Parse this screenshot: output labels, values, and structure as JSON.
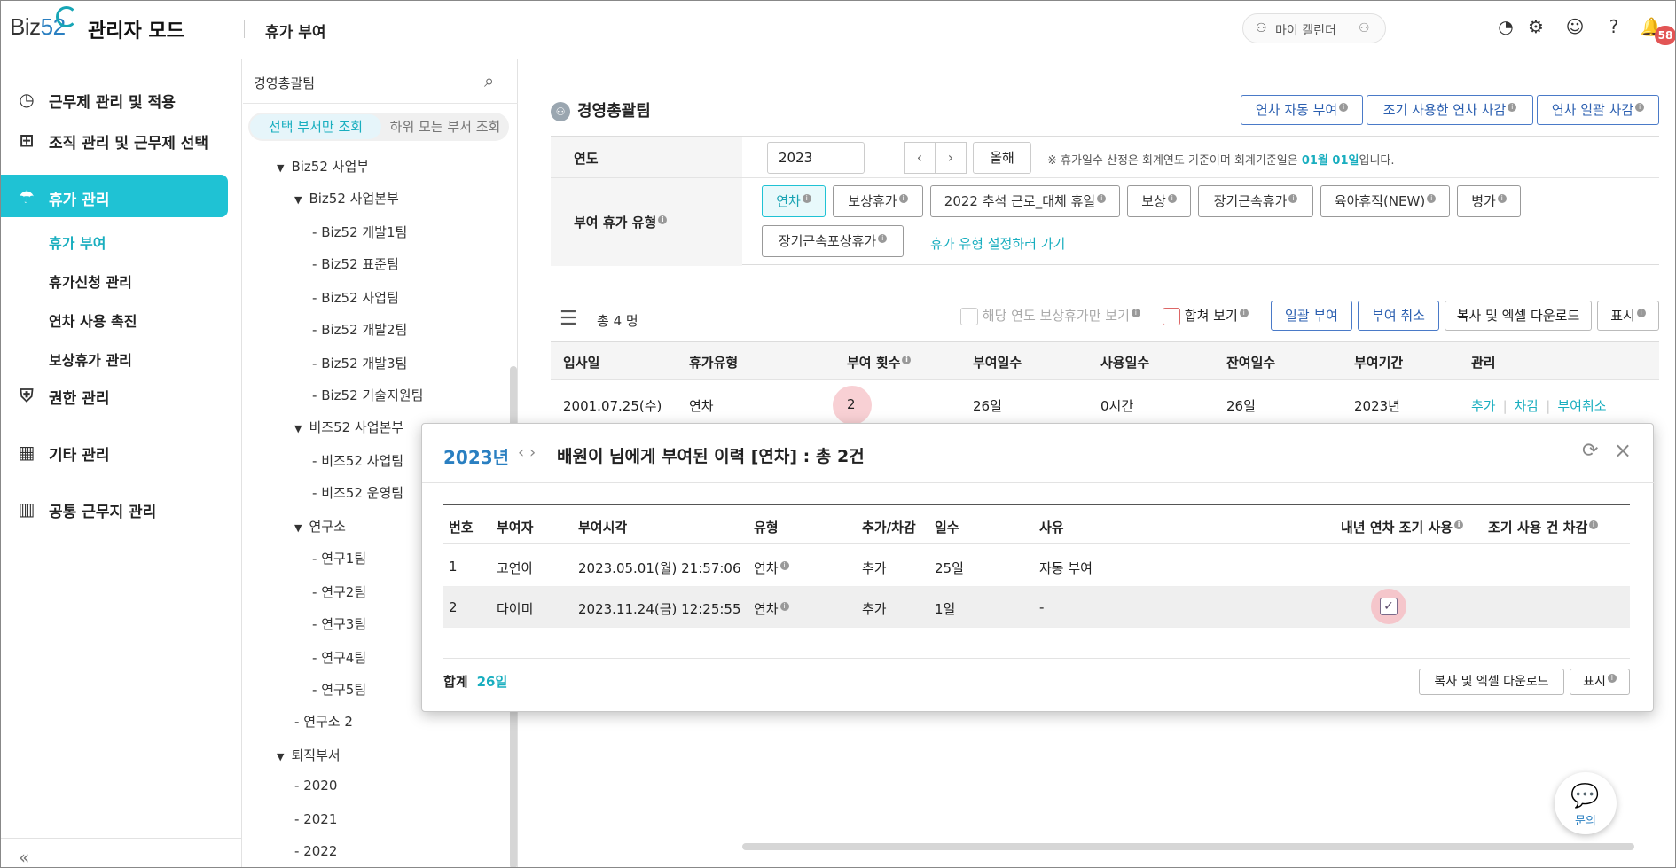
{
  "header": {
    "logo_text": "Biz",
    "logo_num": "52",
    "admin_mode": "관리자 모드",
    "page_title": "휴가 부여",
    "my_calendar": "마이 캘린더",
    "notification_count": "58"
  },
  "leftnav": {
    "items": [
      {
        "label": "근무제 관리 및 적용",
        "icon": "clock-icon"
      },
      {
        "label": "조직 관리 및 근무제 선택",
        "icon": "org-chart-icon"
      },
      {
        "label": "휴가 관리",
        "icon": "umbrella-icon"
      },
      {
        "label": "권한 관리",
        "icon": "shield-icon"
      },
      {
        "label": "기타 관리",
        "icon": "grid-icon"
      },
      {
        "label": "공통 근무지 관리",
        "icon": "building-icon"
      }
    ],
    "sub_items": [
      "휴가 부여",
      "휴가신청 관리",
      "연차 사용 촉진",
      "보상휴가 관리"
    ],
    "collapse": "«"
  },
  "tree": {
    "search_value": "경영총괄팀",
    "seg_on": "선택 부서만 조회",
    "seg_off": "하위 모든 부서 조회",
    "nodes": [
      "Biz52 사업부",
      "Biz52 사업본부",
      "Biz52 개발1팀",
      "Biz52 표준팀",
      "Biz52 사업팀",
      "Biz52 개발2팀",
      "Biz52 개발3팀",
      "Biz52 기술지원팀",
      "비즈52 사업본부",
      "비즈52 사업팀",
      "비즈52 운영팀",
      "연구소",
      "연구1팀",
      "연구2팀",
      "연구3팀",
      "연구4팀",
      "연구5팀",
      "연구소 2",
      "퇴직부서",
      "2020",
      "2021",
      "2022"
    ]
  },
  "main": {
    "team_title": "경영총괄팀",
    "buttons": {
      "auto_grant": "연차 자동 부여",
      "early_deduct": "조기 사용한 연차 차감",
      "bulk_deduct": "연차 일괄 차감"
    },
    "filter": {
      "year_label": "연도",
      "year_value": "2023",
      "this_year": "올해",
      "note_prefix": "※  휴가일수 산정은 회계연도 기준이며 회계기준일은 ",
      "note_date": "01월 01일",
      "note_suffix": "입니다.",
      "type_label": "부여 휴가 유형",
      "types": [
        "연차",
        "보상휴가",
        "2022 추석 근로_대체 휴일",
        "보상",
        "장기근속휴가",
        "육아휴직(NEW)",
        "병가",
        "장기근속포상휴가"
      ],
      "goto_link": "휴가 유형 설정하러 가기"
    },
    "list": {
      "total": "총 4 명",
      "only_comp": "해당 연도 보상휴가만 보기",
      "merged_view": "합쳐 보기",
      "bulk_grant": "일괄 부여",
      "cancel_grant": "부여 취소",
      "copy_excel": "복사 및 엑셀 다운로드",
      "display": "표시"
    },
    "table": {
      "headers": [
        "입사일",
        "휴가유형",
        "부여 횟수",
        "부여일수",
        "사용일수",
        "잔여일수",
        "부여기간",
        "관리"
      ],
      "row": {
        "join_date": "2001.07.25(수)",
        "type": "연차",
        "count": "2",
        "granted": "26일",
        "used": "0시간",
        "remaining": "26일",
        "period": "2023년",
        "add": "추가",
        "deduct": "차감",
        "cancel": "부여취소"
      }
    }
  },
  "modal": {
    "year": "2023년",
    "title": "배원이 님에게 부여된 이력 [연차] : 총 2건",
    "headers": [
      "번호",
      "부여자",
      "부여시각",
      "유형",
      "추가/차감",
      "일수",
      "사유",
      "내년 연차 조기 사용",
      "조기 사용 건 차감"
    ],
    "rows": [
      {
        "no": "1",
        "granter": "고연아",
        "time": "2023.05.01(월) 21:57:06",
        "type": "연차",
        "op": "추가",
        "days": "25일",
        "reason": "자동 부여"
      },
      {
        "no": "2",
        "granter": "다이미",
        "time": "2023.11.24(금) 12:25:55",
        "type": "연차",
        "op": "추가",
        "days": "1일",
        "reason": "-"
      }
    ],
    "sum_label": "합계",
    "sum_value": "26일",
    "copy_excel": "복사 및 엑셀 다운로드",
    "display": "표시"
  },
  "chat": {
    "label": "문의"
  }
}
